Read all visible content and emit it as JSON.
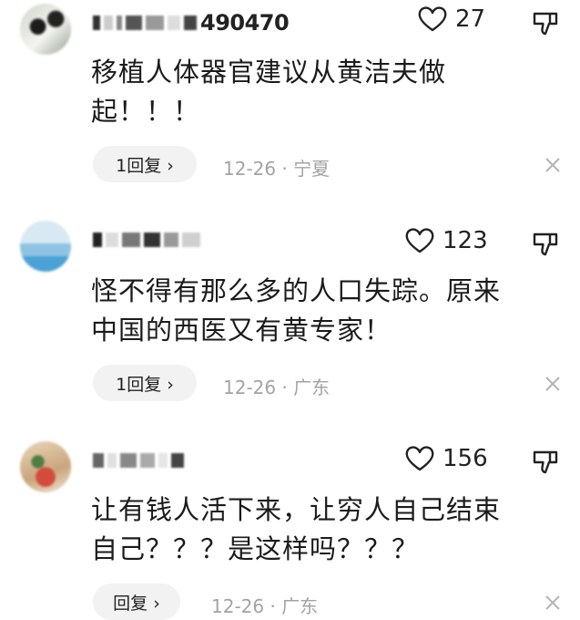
{
  "comments": [
    {
      "username_visible": "490470",
      "likes": "27",
      "text": "移植人体器官建议从黄洁夫做\n起！！！",
      "reply_label": "1回复 ›",
      "meta": "12-26 · 宁夏"
    },
    {
      "username_visible": "",
      "likes": "123",
      "text": "怪不得有那么多的人口失踪。原来\n中国的西医又有黄专家！",
      "reply_label": "1回复 ›",
      "meta": "12-26 · 广东"
    },
    {
      "username_visible": "",
      "likes": "156",
      "text": "让有钱人活下来，让穷人自己结束\n自己？？？是这样吗？？？",
      "reply_label": "回复 ›",
      "meta": "12-26 · 广东"
    }
  ],
  "icons": {
    "like": "heart-outline-icon",
    "dislike": "thumbs-down-icon",
    "close": "close-icon"
  }
}
